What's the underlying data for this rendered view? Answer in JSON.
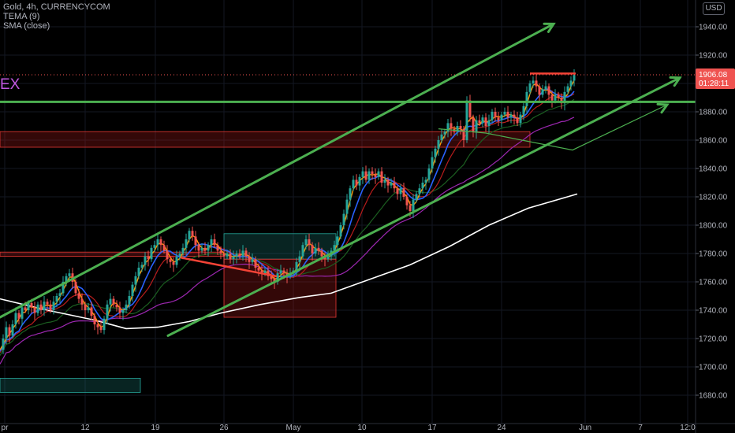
{
  "legend": {
    "symbol": "Gold, 4h, CURRENCYCOM",
    "ind1": "TEMA (9)",
    "ind2": "SMA (close)"
  },
  "currency_button": "USD",
  "watermark": "EX",
  "price_label": {
    "value": "1906.08",
    "countdown": "01:28:11"
  },
  "colors": {
    "bg": "#000000",
    "up": "#26a69a",
    "down": "#ef5350",
    "drawing_green": "#4caf50",
    "tema": "#ff9800",
    "sma": "#ffffff",
    "ema_blue": "#2962ff",
    "ema_purple": "#9c27b0",
    "ema_darkgreen": "#1b5e20",
    "ema_red": "#b71c1c"
  },
  "chart_data": {
    "type": "candlestick",
    "x_tick_labels": [
      "pr",
      "12",
      "19",
      "26",
      "May",
      "10",
      "17",
      "24",
      "Jun",
      "7",
      "12:0"
    ],
    "y_tick_labels": [
      "1680.00",
      "1700.00",
      "1720.00",
      "1740.00",
      "1760.00",
      "1780.00",
      "1800.00",
      "1820.00",
      "1840.00",
      "1860.00",
      "1880.00",
      "1900.00",
      "1920.00",
      "1940.00"
    ],
    "ylim": [
      1674,
      1952
    ],
    "last_price": 1906.08,
    "close_path": [
      [
        0,
        1712
      ],
      [
        4,
        1720
      ],
      [
        8,
        1728
      ],
      [
        12,
        1722
      ],
      [
        16,
        1730
      ],
      [
        20,
        1738
      ],
      [
        24,
        1734
      ],
      [
        28,
        1742
      ],
      [
        32,
        1740
      ],
      [
        36,
        1745
      ],
      [
        40,
        1742
      ],
      [
        44,
        1738
      ],
      [
        48,
        1744
      ],
      [
        52,
        1740
      ],
      [
        56,
        1746
      ],
      [
        60,
        1744
      ],
      [
        64,
        1740
      ],
      [
        68,
        1746
      ],
      [
        72,
        1750
      ],
      [
        76,
        1752
      ],
      [
        80,
        1760
      ],
      [
        84,
        1764
      ],
      [
        88,
        1766
      ],
      [
        92,
        1760
      ],
      [
        96,
        1752
      ],
      [
        100,
        1748
      ],
      [
        104,
        1744
      ],
      [
        108,
        1740
      ],
      [
        112,
        1742
      ],
      [
        116,
        1736
      ],
      [
        120,
        1730
      ],
      [
        124,
        1728
      ],
      [
        128,
        1726
      ],
      [
        132,
        1734
      ],
      [
        136,
        1744
      ],
      [
        140,
        1748
      ],
      [
        144,
        1744
      ],
      [
        148,
        1742
      ],
      [
        152,
        1738
      ],
      [
        156,
        1740
      ],
      [
        160,
        1744
      ],
      [
        164,
        1750
      ],
      [
        168,
        1758
      ],
      [
        172,
        1764
      ],
      [
        176,
        1770
      ],
      [
        180,
        1772
      ],
      [
        184,
        1778
      ],
      [
        188,
        1776
      ],
      [
        192,
        1784
      ],
      [
        196,
        1786
      ],
      [
        200,
        1790
      ],
      [
        204,
        1786
      ],
      [
        208,
        1782
      ],
      [
        212,
        1776
      ],
      [
        216,
        1774
      ],
      [
        220,
        1772
      ],
      [
        224,
        1778
      ],
      [
        228,
        1780
      ],
      [
        232,
        1784
      ],
      [
        236,
        1790
      ],
      [
        240,
        1796
      ],
      [
        244,
        1792
      ],
      [
        248,
        1786
      ],
      [
        252,
        1782
      ],
      [
        256,
        1784
      ],
      [
        260,
        1782
      ],
      [
        264,
        1786
      ],
      [
        268,
        1790
      ],
      [
        272,
        1786
      ],
      [
        276,
        1782
      ],
      [
        280,
        1780
      ],
      [
        284,
        1778
      ],
      [
        288,
        1780
      ],
      [
        292,
        1776
      ],
      [
        296,
        1778
      ],
      [
        300,
        1780
      ],
      [
        304,
        1778
      ],
      [
        308,
        1782
      ],
      [
        312,
        1778
      ],
      [
        316,
        1774
      ],
      [
        320,
        1776
      ],
      [
        324,
        1770
      ],
      [
        328,
        1768
      ],
      [
        332,
        1766
      ],
      [
        336,
        1768
      ],
      [
        340,
        1764
      ],
      [
        344,
        1762
      ],
      [
        348,
        1760
      ],
      [
        352,
        1766
      ],
      [
        356,
        1768
      ],
      [
        360,
        1766
      ],
      [
        364,
        1764
      ],
      [
        368,
        1766
      ],
      [
        372,
        1768
      ],
      [
        376,
        1774
      ],
      [
        380,
        1778
      ],
      [
        384,
        1786
      ],
      [
        388,
        1790
      ],
      [
        392,
        1786
      ],
      [
        396,
        1780
      ],
      [
        400,
        1784
      ],
      [
        404,
        1782
      ],
      [
        408,
        1778
      ],
      [
        412,
        1776
      ],
      [
        416,
        1778
      ],
      [
        420,
        1782
      ],
      [
        424,
        1786
      ],
      [
        428,
        1792
      ],
      [
        432,
        1800
      ],
      [
        436,
        1808
      ],
      [
        440,
        1818
      ],
      [
        444,
        1826
      ],
      [
        448,
        1832
      ],
      [
        452,
        1828
      ],
      [
        456,
        1834
      ],
      [
        460,
        1838
      ],
      [
        464,
        1832
      ],
      [
        468,
        1838
      ],
      [
        472,
        1836
      ],
      [
        476,
        1834
      ],
      [
        480,
        1838
      ],
      [
        484,
        1830
      ],
      [
        488,
        1832
      ],
      [
        492,
        1828
      ],
      [
        496,
        1830
      ],
      [
        500,
        1826
      ],
      [
        504,
        1822
      ],
      [
        508,
        1826
      ],
      [
        512,
        1820
      ],
      [
        516,
        1814
      ],
      [
        520,
        1810
      ],
      [
        524,
        1818
      ],
      [
        528,
        1822
      ],
      [
        532,
        1826
      ],
      [
        536,
        1830
      ],
      [
        540,
        1832
      ],
      [
        544,
        1840
      ],
      [
        548,
        1848
      ],
      [
        552,
        1854
      ],
      [
        556,
        1860
      ],
      [
        560,
        1864
      ],
      [
        564,
        1866
      ],
      [
        568,
        1872
      ],
      [
        572,
        1868
      ],
      [
        576,
        1866
      ],
      [
        580,
        1870
      ],
      [
        584,
        1868
      ],
      [
        588,
        1860
      ],
      [
        592,
        1888
      ],
      [
        596,
        1876
      ],
      [
        600,
        1866
      ],
      [
        604,
        1874
      ],
      [
        608,
        1872
      ],
      [
        612,
        1876
      ],
      [
        616,
        1870
      ],
      [
        620,
        1874
      ],
      [
        624,
        1880
      ],
      [
        628,
        1876
      ],
      [
        632,
        1874
      ],
      [
        636,
        1878
      ],
      [
        640,
        1880
      ],
      [
        644,
        1876
      ],
      [
        648,
        1878
      ],
      [
        652,
        1876
      ],
      [
        656,
        1872
      ],
      [
        660,
        1878
      ],
      [
        664,
        1884
      ],
      [
        668,
        1894
      ],
      [
        672,
        1900
      ],
      [
        676,
        1902
      ],
      [
        680,
        1898
      ],
      [
        684,
        1892
      ],
      [
        688,
        1896
      ],
      [
        692,
        1898
      ],
      [
        696,
        1892
      ],
      [
        700,
        1888
      ],
      [
        704,
        1892
      ],
      [
        708,
        1890
      ],
      [
        712,
        1886
      ],
      [
        716,
        1894
      ],
      [
        720,
        1898
      ],
      [
        724,
        1902
      ],
      [
        728,
        1906
      ]
    ],
    "sma_path": [
      [
        0,
        1748
      ],
      [
        60,
        1740
      ],
      [
        120,
        1733
      ],
      [
        160,
        1727
      ],
      [
        200,
        1728
      ],
      [
        240,
        1732
      ],
      [
        280,
        1738
      ],
      [
        330,
        1744
      ],
      [
        380,
        1749
      ],
      [
        420,
        1752
      ],
      [
        470,
        1762
      ],
      [
        520,
        1772
      ],
      [
        570,
        1785
      ],
      [
        620,
        1800
      ],
      [
        670,
        1812
      ],
      [
        732,
        1822
      ]
    ],
    "channel_upper": [
      [
        0,
        1735
      ],
      [
        702,
        1942
      ]
    ],
    "channel_lower": [
      [
        213,
        1722
      ],
      [
        862,
        1904
      ]
    ],
    "horizontal_line": {
      "y": 1887
    },
    "zones": [
      {
        "type": "resistance",
        "x0": 0,
        "x1": 672,
        "y0": 1855,
        "y1": 1866
      },
      {
        "type": "resistance",
        "x0": 0,
        "x1": 284,
        "y0": 1778,
        "y1": 1781
      },
      {
        "type": "support",
        "x0": 0,
        "x1": 178,
        "y0": 1682,
        "y1": 1692
      },
      {
        "type": "accumulation",
        "x0": 284,
        "x1": 426,
        "y0": 1776,
        "y1": 1794
      },
      {
        "type": "distribution",
        "x0": 284,
        "x1": 426,
        "y0": 1735,
        "y1": 1776
      }
    ],
    "projection": [
      [
        556,
        1868
      ],
      [
        616,
        1865
      ],
      [
        726,
        1853
      ],
      [
        846,
        1885
      ]
    ],
    "top_resistance": {
      "x0": 672,
      "x1": 730,
      "y": 1907
    },
    "trendline_red": [
      [
        230,
        1777
      ],
      [
        350,
        1764
      ]
    ]
  }
}
